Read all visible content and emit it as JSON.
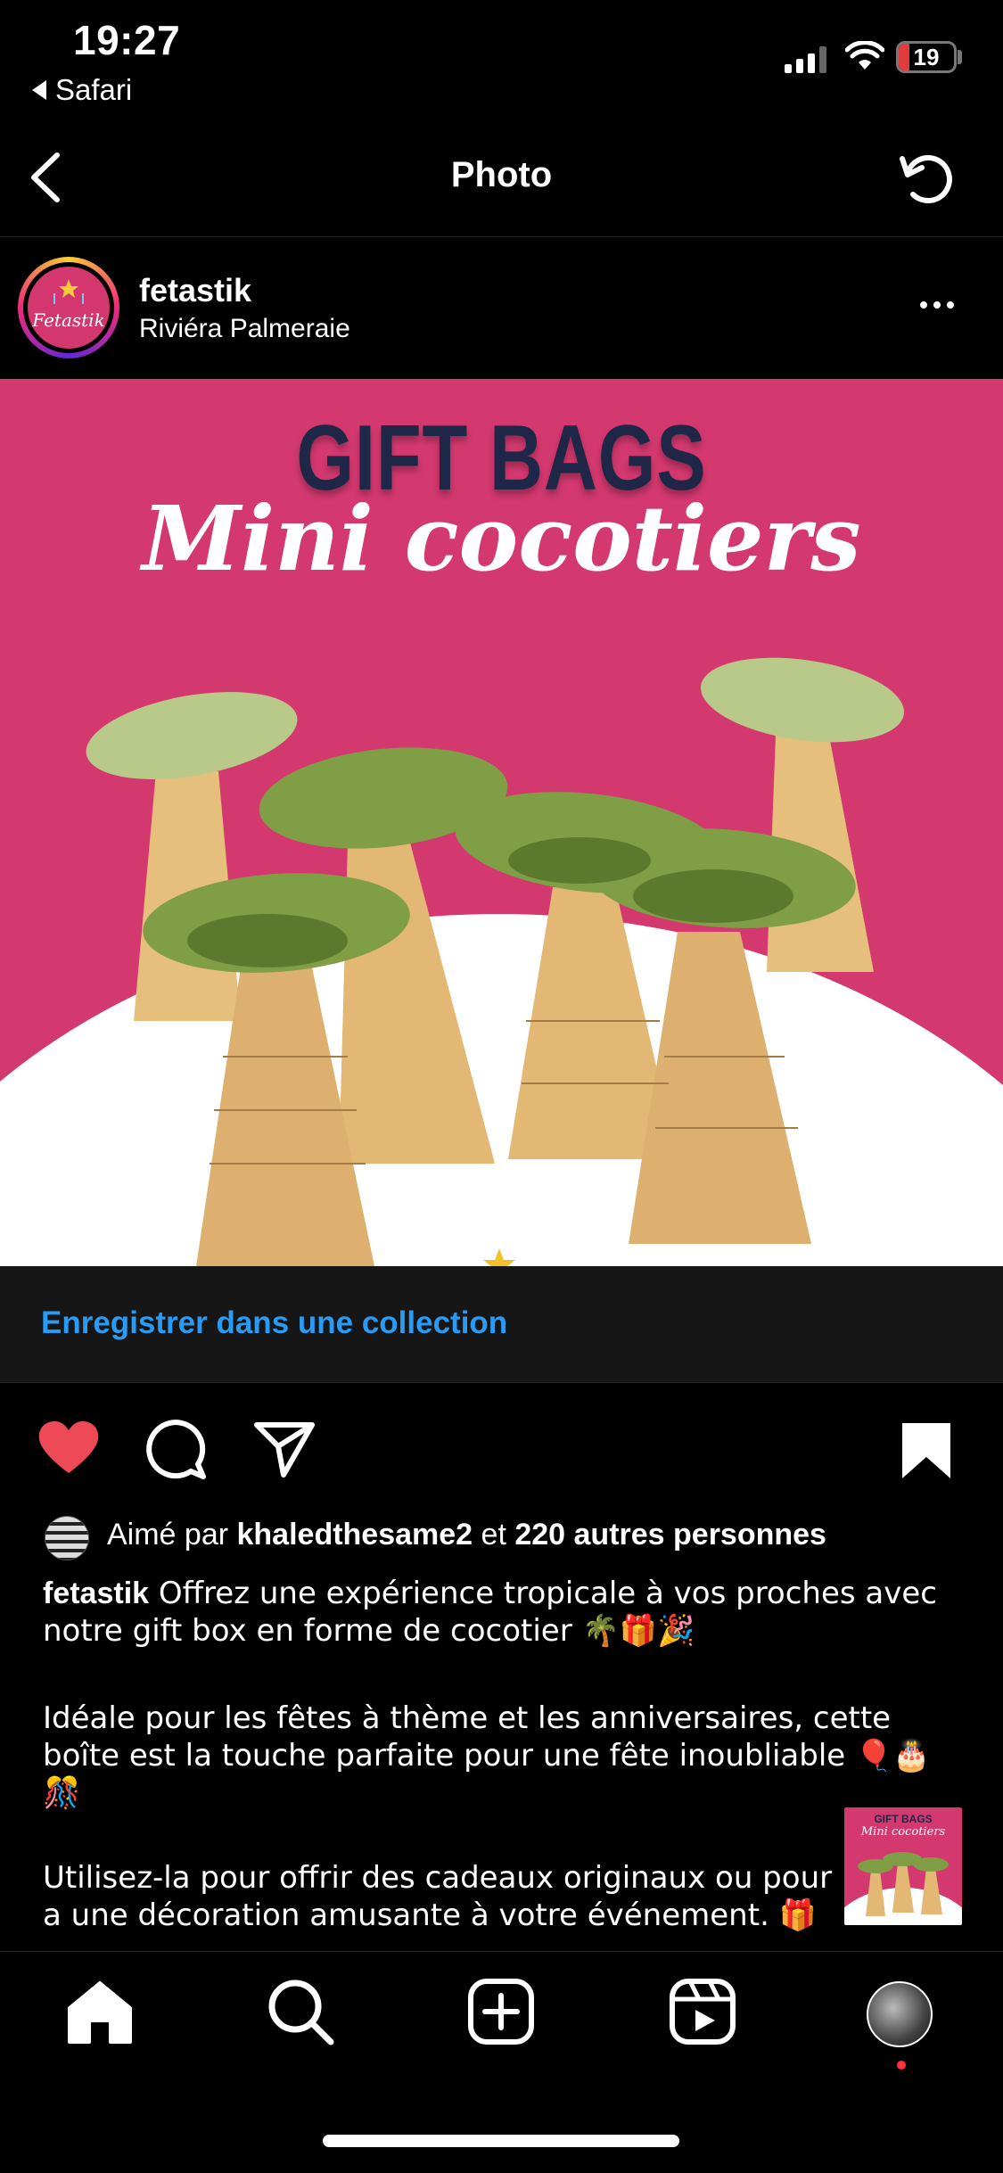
{
  "status_bar": {
    "time": "19:27",
    "back_app": "Safari",
    "battery": "19",
    "battery_level": 0.19
  },
  "nav": {
    "title": "Photo",
    "back_icon": "chevron-left-icon",
    "refresh_icon": "refresh-icon"
  },
  "post": {
    "username": "fetastik",
    "location": "Riviéra Palmeraie",
    "avatar_text": "Fetastik",
    "image": {
      "title_line1": "GIFT BAGS",
      "title_line2": "Mini cocotiers",
      "background_color": "#d3386f"
    }
  },
  "save_collection": {
    "label": "Enregistrer dans une collection",
    "color": "#2a9bf4"
  },
  "actions": {
    "liked": true,
    "saved": true,
    "like_color": "#ed4956"
  },
  "likes": {
    "prefix": "Aimé par ",
    "user": "khaledthesame2",
    "middle": " et ",
    "others": "220 autres personnes"
  },
  "caption": {
    "username": "fetastik",
    "paragraph1": " Offrez une expérience tropicale à vos proches avec notre gift box en forme de cocotier 🌴🎁🎉",
    "paragraph2": "Idéale pour les fêtes à thème et les anniversaires, cette boîte est la touche parfaite pour une fête inoubliable 🎈🎂🎊",
    "paragraph3": "Utilisez-la pour offrir des cadeaux originaux ou pour a une décoration amusante à votre événement. 🎁"
  },
  "thumbnail": {
    "title_line1": "GIFT BAGS",
    "title_line2": "Mini cocotiers"
  },
  "tab_bar": {
    "items": [
      "home-icon",
      "search-icon",
      "new-post-icon",
      "reels-icon",
      "profile-avatar"
    ]
  }
}
